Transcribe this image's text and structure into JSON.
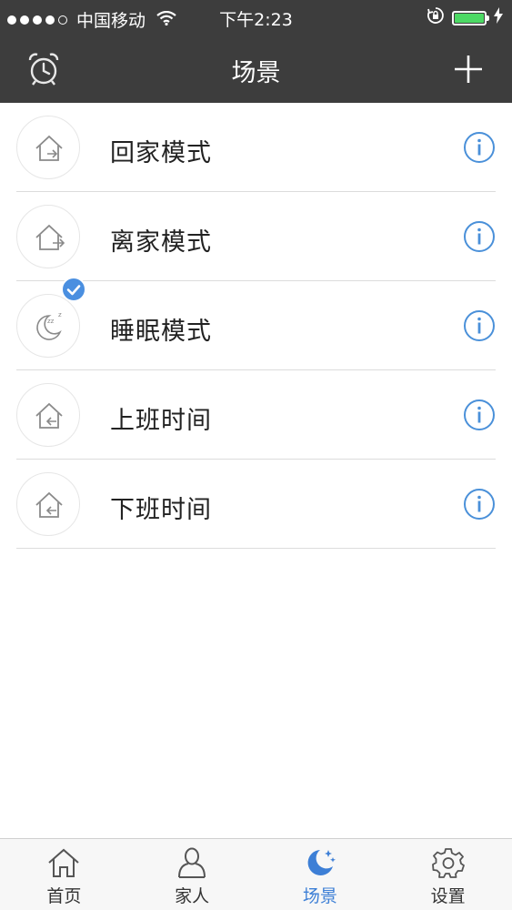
{
  "status_bar": {
    "carrier": "中国移动",
    "time": "下午2:23",
    "battery_color": "#4cd964"
  },
  "navbar": {
    "title": "场景",
    "left_icon": "alarm-clock-icon",
    "right_icon": "plus-icon"
  },
  "scenes": [
    {
      "label": "回家模式",
      "icon": "house-arrow-icon",
      "selected": false
    },
    {
      "label": "离家模式",
      "icon": "house-arrow-icon",
      "selected": false
    },
    {
      "label": "睡眠模式",
      "icon": "moon-sleep-icon",
      "selected": false
    },
    {
      "label": "上班时间",
      "icon": "house-arrow-icon",
      "selected": true
    },
    {
      "label": "下班时间",
      "icon": "house-arrow-icon",
      "selected": false
    }
  ],
  "tabs": [
    {
      "label": "首页",
      "icon": "home-icon",
      "active": false
    },
    {
      "label": "家人",
      "icon": "person-icon",
      "active": false
    },
    {
      "label": "场景",
      "icon": "moon-stars-icon",
      "active": true
    },
    {
      "label": "设置",
      "icon": "gear-icon",
      "active": false
    }
  ],
  "colors": {
    "header_bg": "#3d3d3d",
    "accent": "#3d7fd6",
    "info_icon": "#4a90d9",
    "check_badge": "#4a8fe0"
  }
}
